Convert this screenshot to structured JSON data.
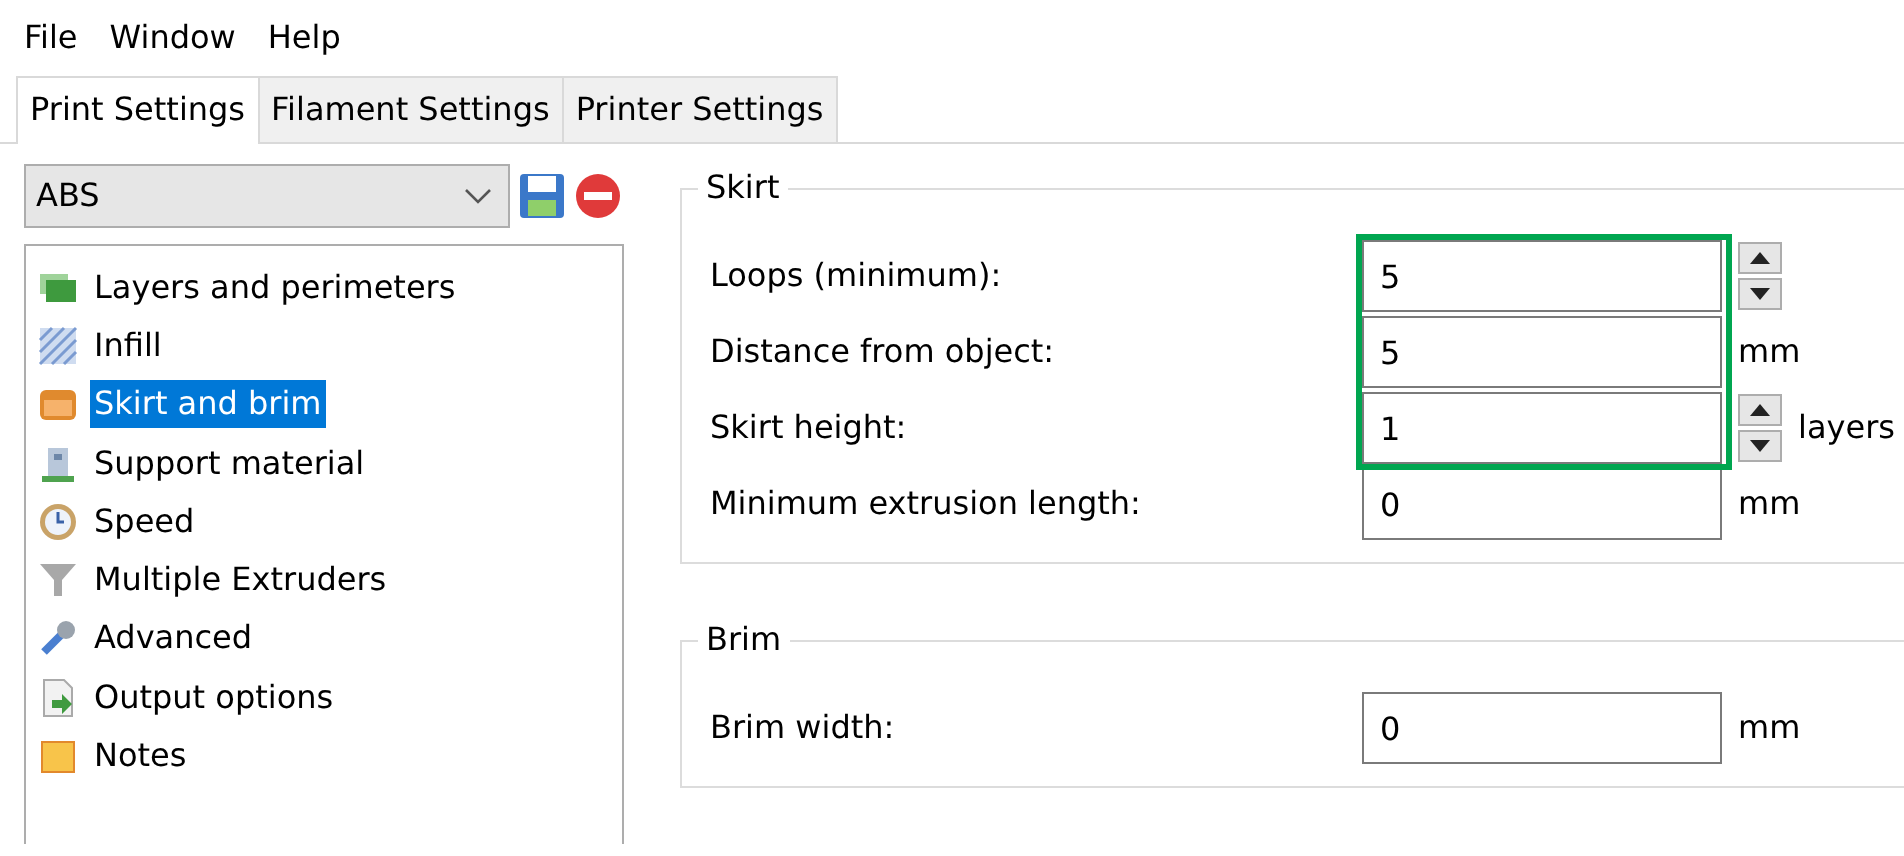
{
  "menu": [
    "File",
    "Window",
    "Help"
  ],
  "tabs": [
    {
      "label": "Print Settings",
      "selected": true
    },
    {
      "label": "Filament Settings",
      "selected": false
    },
    {
      "label": "Printer Settings",
      "selected": false
    }
  ],
  "preset": {
    "value": "ABS"
  },
  "sidebar": {
    "items": [
      {
        "label": "Layers and perimeters",
        "selected": false
      },
      {
        "label": "Infill",
        "selected": false
      },
      {
        "label": "Skirt and brim",
        "selected": true
      },
      {
        "label": "Support material",
        "selected": false
      },
      {
        "label": "Speed",
        "selected": false
      },
      {
        "label": "Multiple Extruders",
        "selected": false
      },
      {
        "label": "Advanced",
        "selected": false
      },
      {
        "label": "Output options",
        "selected": false
      },
      {
        "label": "Notes",
        "selected": false
      }
    ]
  },
  "groups": [
    {
      "title": "Skirt",
      "rows": [
        {
          "label": "Loops (minimum):",
          "value": "5",
          "kind": "spin",
          "highlighted": true
        },
        {
          "label": "Distance from object:",
          "value": "5",
          "kind": "plain",
          "unit": "mm",
          "highlighted": true
        },
        {
          "label": "Skirt height:",
          "value": "1",
          "kind": "spin",
          "unit": "layers",
          "highlighted": true
        },
        {
          "label": "Minimum extrusion length:",
          "value": "0",
          "kind": "plain",
          "unit": "mm",
          "highlighted": false
        }
      ]
    },
    {
      "title": "Brim",
      "rows": [
        {
          "label": "Brim width:",
          "value": "0",
          "kind": "plain",
          "unit": "mm",
          "highlighted": false
        }
      ]
    }
  ]
}
